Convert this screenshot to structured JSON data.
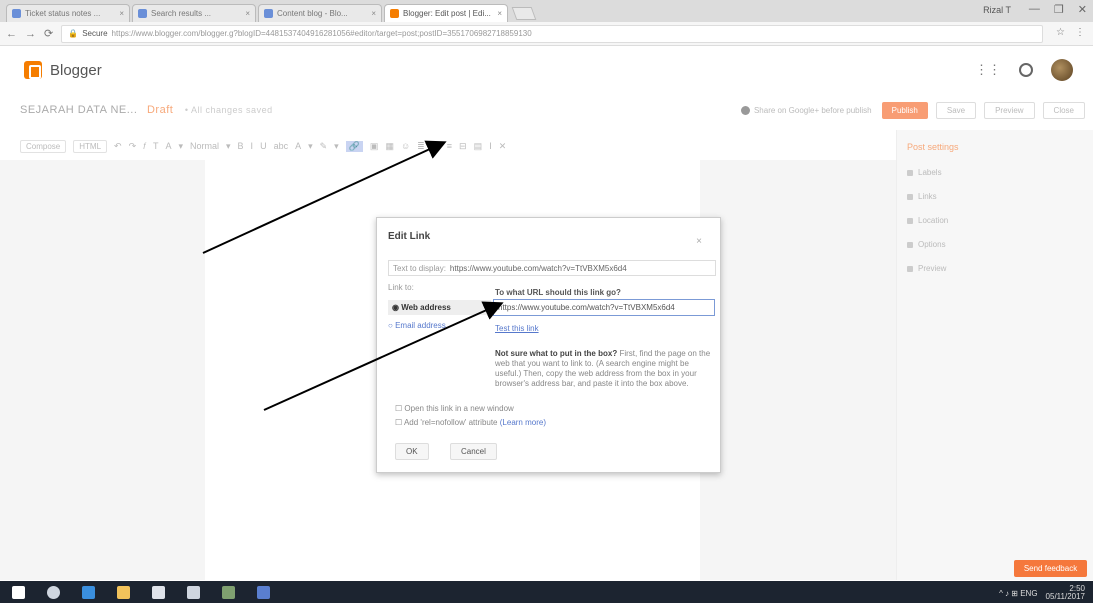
{
  "browser": {
    "tabs": [
      {
        "label": "Ticket status notes ..."
      },
      {
        "label": "Search results ..."
      },
      {
        "label": "Content blog - Blo..."
      },
      {
        "label": "Blogger: Edit post | Edi..."
      }
    ],
    "profile": "Rizal T",
    "window_controls": [
      "—",
      "❐",
      "✕"
    ],
    "secure_label": "Secure",
    "url": "https://www.blogger.com/blogger.g?blogID=4481537404916281056#editor/target=post;postID=3551706982718859130"
  },
  "header": {
    "brand": "Blogger"
  },
  "post": {
    "title": "SEJARAH DATA NE...",
    "status": "Draft",
    "meta": "• All changes saved",
    "gplus_note": "Share on Google+ before publish",
    "actions": [
      "Publish",
      "Save",
      "Preview",
      "Close"
    ]
  },
  "toolbar": {
    "compose": "Compose",
    "html": "HTML",
    "icons": [
      "↶",
      "↷",
      "𝑓",
      "T",
      "A",
      "▾",
      "Normal",
      "▾",
      "B",
      "I",
      "U",
      "abc",
      "A",
      "▾",
      "✎",
      "▾",
      "🔗",
      "▣",
      "▦",
      "☺",
      "≣",
      "☰",
      "≡",
      "⊟",
      "▤",
      "Ⅰ",
      "✕"
    ]
  },
  "side_panel": {
    "title": "Post settings",
    "items": [
      "Labels",
      "Links",
      "Location",
      "Options",
      "Preview"
    ]
  },
  "dialog": {
    "title": "Edit Link",
    "close": "×",
    "text_to_display_label": "Text to display:",
    "text_to_display_value": "https://www.youtube.com/watch?v=TtVBXM5x6d4",
    "link_to_label": "Link to:",
    "option_web": "Web address",
    "option_email": "Email address",
    "question": "To what URL should this link go?",
    "url_value": "https://www.youtube.com/watch?v=TtVBXM5x6d4",
    "test_link": "Test this link",
    "help_bold": "Not sure what to put in the box?",
    "help_text": "First, find the page on the web that you want to link to. (A search engine might be useful.) Then, copy the web address from the box in your browser's address bar, and paste it into the box above.",
    "checkbox1": "Open this link in a new window",
    "checkbox2": "Add 'rel=nofollow' attribute",
    "checkbox2_link": "(Learn more)",
    "ok": "OK",
    "cancel": "Cancel"
  },
  "feedback": "Send feedback",
  "taskbar": {
    "apps": [
      {
        "name": "windows-start",
        "color": "#ffffff"
      },
      {
        "name": "search",
        "color": "#cfd6e0"
      },
      {
        "name": "edge",
        "color": "#3a8fde"
      },
      {
        "name": "files",
        "color": "#f2c35b"
      },
      {
        "name": "store",
        "color": "#dfe3ea"
      },
      {
        "name": "photos",
        "color": "#cfd6e0"
      },
      {
        "name": "chrome",
        "color": "#7fa070"
      },
      {
        "name": "word",
        "color": "#5a7fd0"
      }
    ],
    "tray": "^ ♪ ⊞ ENG",
    "time": "2:50",
    "date": "05/11/2017"
  }
}
